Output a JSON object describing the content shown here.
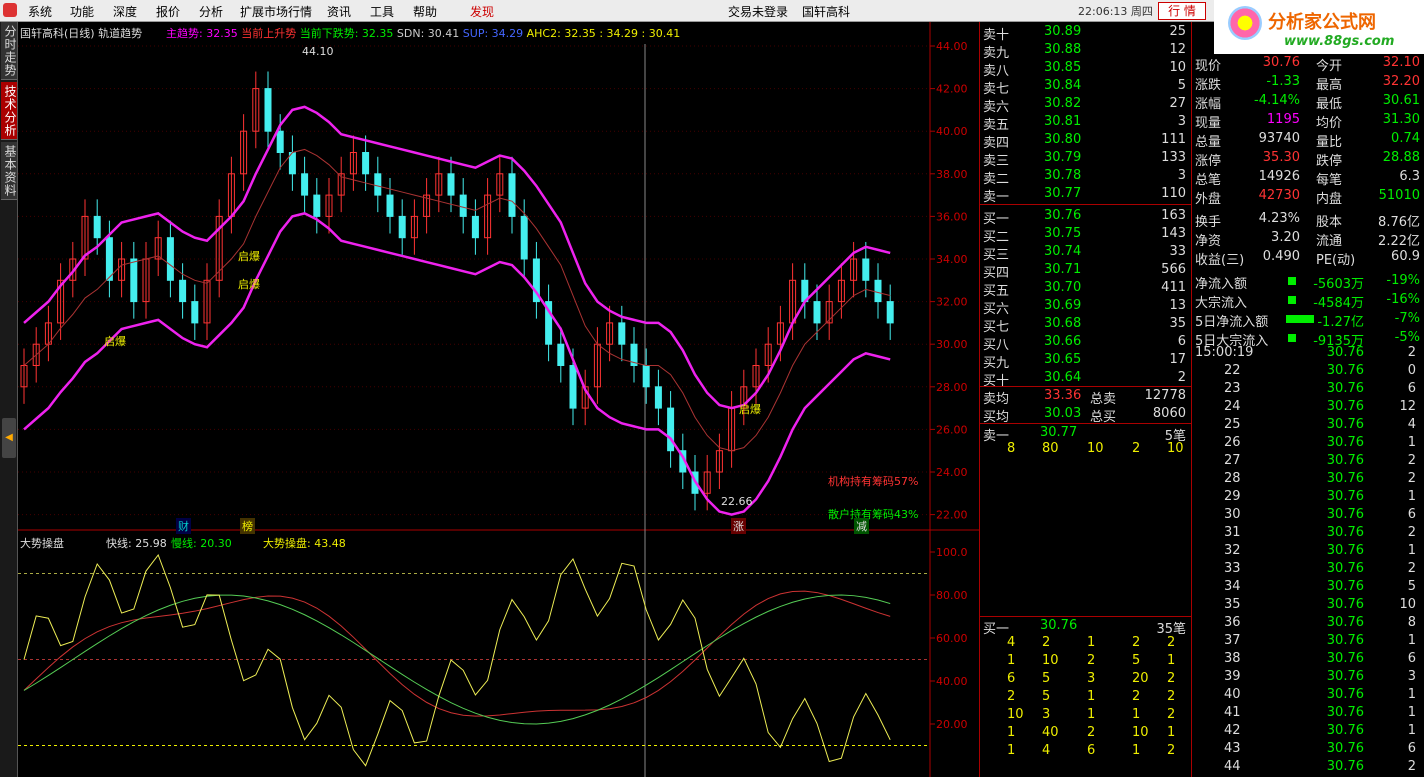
{
  "menubar": {
    "items": [
      "系统",
      "功能",
      "深度",
      "报价",
      "分析",
      "扩展市场行情",
      "资讯",
      "工具",
      "帮助"
    ],
    "discover": "发现",
    "center1": "交易未登录",
    "center2": "国轩高科",
    "clock": "22:06:13 周四",
    "tab": "行 情"
  },
  "brand": {
    "title": "分析家公式网",
    "url": "www.88gs.com"
  },
  "left_tabs": [
    "分时走势",
    "技术分析",
    "基本资料"
  ],
  "main_chart": {
    "title": "国轩高科(日线) 轨道趋势",
    "indicators": [
      {
        "label": "主趋势: 32.35",
        "color": "#ff00ff"
      },
      {
        "label": "当前上升势",
        "color": "#ff3333"
      },
      {
        "label": "当前下跌势: 32.35",
        "color": "#00ee00"
      },
      {
        "label": "SDN: 30.41",
        "color": "#cccccc"
      },
      {
        "label": "SUP: 34.29",
        "color": "#4466ff"
      },
      {
        "label": "AHC2: 32.35",
        "color": "#eeee00"
      },
      {
        "label": ": 34.29",
        "color": "#eeee00"
      },
      {
        "label": ": 30.41",
        "color": "#eeee00"
      }
    ],
    "annotations": {
      "high": "44.10",
      "low": "22.66",
      "qibao": "启爆",
      "inst": "机构持有筹码57%",
      "retail": "散户持有筹码43%",
      "cai": "财",
      "bang": "榜",
      "zhang": "涨",
      "jian": "减"
    },
    "price_axis": [
      "44.00",
      "42.00",
      "40.00",
      "38.00",
      "36.00",
      "34.00",
      "32.00",
      "30.00",
      "28.00",
      "26.00",
      "24.00",
      "22.00"
    ]
  },
  "osc": {
    "title": "大势操盘",
    "fast": "快线: 25.98",
    "slow": "慢线: 20.30",
    "big": "大势操盘: 43.48",
    "axis": [
      "100.0",
      "80.00",
      "60.00",
      "40.00",
      "20.00"
    ]
  },
  "chart_data": {
    "type": "candlestick",
    "title": "国轩高科(日线) 轨道趋势",
    "high": 44.1,
    "low": 22.66,
    "ylim": [
      22,
      44
    ]
  },
  "order_book": {
    "sell": [
      [
        "卖十",
        "30.89",
        "25"
      ],
      [
        "卖九",
        "30.88",
        "12"
      ],
      [
        "卖八",
        "30.85",
        "10"
      ],
      [
        "卖七",
        "30.84",
        "5"
      ],
      [
        "卖六",
        "30.82",
        "27"
      ],
      [
        "卖五",
        "30.81",
        "3"
      ],
      [
        "卖四",
        "30.80",
        "111"
      ],
      [
        "卖三",
        "30.79",
        "133"
      ],
      [
        "卖二",
        "30.78",
        "3"
      ],
      [
        "卖一",
        "30.77",
        "110"
      ]
    ],
    "buy": [
      [
        "买一",
        "30.76",
        "163"
      ],
      [
        "买二",
        "30.75",
        "143"
      ],
      [
        "买三",
        "30.74",
        "33"
      ],
      [
        "买四",
        "30.71",
        "566"
      ],
      [
        "买五",
        "30.70",
        "411"
      ],
      [
        "买六",
        "30.69",
        "13"
      ],
      [
        "买七",
        "30.68",
        "35"
      ],
      [
        "买八",
        "30.66",
        "6"
      ],
      [
        "买九",
        "30.65",
        "17"
      ],
      [
        "买十",
        "30.64",
        "2"
      ]
    ],
    "sell_avg": [
      "卖均",
      "33.36",
      "总卖",
      "12778"
    ],
    "buy_avg": [
      "买均",
      "30.03",
      "总买",
      "8060"
    ],
    "sell1_queue": {
      "label": "卖一",
      "price": "30.77",
      "count": "5笔",
      "orders": [
        "8",
        "80",
        "10",
        "2",
        "10"
      ]
    },
    "buy1_queue": {
      "label": "买一",
      "price": "30.76",
      "count": "35笔",
      "orders": [
        [
          "4",
          "2",
          "1",
          "2",
          "2"
        ],
        [
          "1",
          "10",
          "2",
          "5",
          "1"
        ],
        [
          "6",
          "5",
          "3",
          "20",
          "2"
        ],
        [
          "2",
          "5",
          "1",
          "2",
          "2"
        ],
        [
          "10",
          "3",
          "1",
          "1",
          "2"
        ],
        [
          "1",
          "40",
          "2",
          "10",
          "1"
        ],
        [
          "1",
          "4",
          "6",
          "1",
          "2"
        ]
      ]
    }
  },
  "stock_info": [
    [
      "现价",
      "30.76",
      "今开",
      "32.10"
    ],
    [
      "涨跌",
      "-1.33",
      "最高",
      "32.20"
    ],
    [
      "涨幅",
      "-4.14%",
      "最低",
      "30.61"
    ],
    [
      "现量",
      "1195",
      "均价",
      "31.30"
    ],
    [
      "总量",
      "93740",
      "量比",
      "0.74"
    ],
    [
      "涨停",
      "35.30",
      "跌停",
      "28.88"
    ],
    [
      "总笔",
      "14926",
      "每笔",
      "6.3"
    ],
    [
      "外盘",
      "42730",
      "内盘",
      "51010"
    ],
    [
      "换手",
      "4.23%",
      "股本",
      "8.76亿"
    ],
    [
      "净资",
      "3.20",
      "流通",
      "2.22亿"
    ],
    [
      "收益(三)",
      "0.490",
      "PE(动)",
      "60.9"
    ]
  ],
  "flows": [
    [
      "净流入额",
      "-5603万",
      "-19%"
    ],
    [
      "大宗流入",
      "-4584万",
      "-16%"
    ],
    [
      "5日净流入额",
      "-1.27亿",
      "-7%"
    ],
    [
      "5日大宗流入",
      "-9135万",
      "-5%"
    ]
  ],
  "ticks": [
    [
      "15:00:19",
      "30.76",
      "2"
    ],
    [
      "22",
      "30.76",
      "0"
    ],
    [
      "23",
      "30.76",
      "6"
    ],
    [
      "24",
      "30.76",
      "12"
    ],
    [
      "25",
      "30.76",
      "4"
    ],
    [
      "26",
      "30.76",
      "1"
    ],
    [
      "27",
      "30.76",
      "2"
    ],
    [
      "28",
      "30.76",
      "2"
    ],
    [
      "29",
      "30.76",
      "1"
    ],
    [
      "30",
      "30.76",
      "6"
    ],
    [
      "31",
      "30.76",
      "2"
    ],
    [
      "32",
      "30.76",
      "1"
    ],
    [
      "33",
      "30.76",
      "2"
    ],
    [
      "34",
      "30.76",
      "5"
    ],
    [
      "35",
      "30.76",
      "10"
    ],
    [
      "36",
      "30.76",
      "8"
    ],
    [
      "37",
      "30.76",
      "1"
    ],
    [
      "38",
      "30.76",
      "6"
    ],
    [
      "39",
      "30.76",
      "3"
    ],
    [
      "40",
      "30.76",
      "1"
    ],
    [
      "41",
      "30.76",
      "1"
    ],
    [
      "42",
      "30.76",
      "1"
    ],
    [
      "43",
      "30.76",
      "6"
    ],
    [
      "44",
      "30.76",
      "2"
    ]
  ]
}
